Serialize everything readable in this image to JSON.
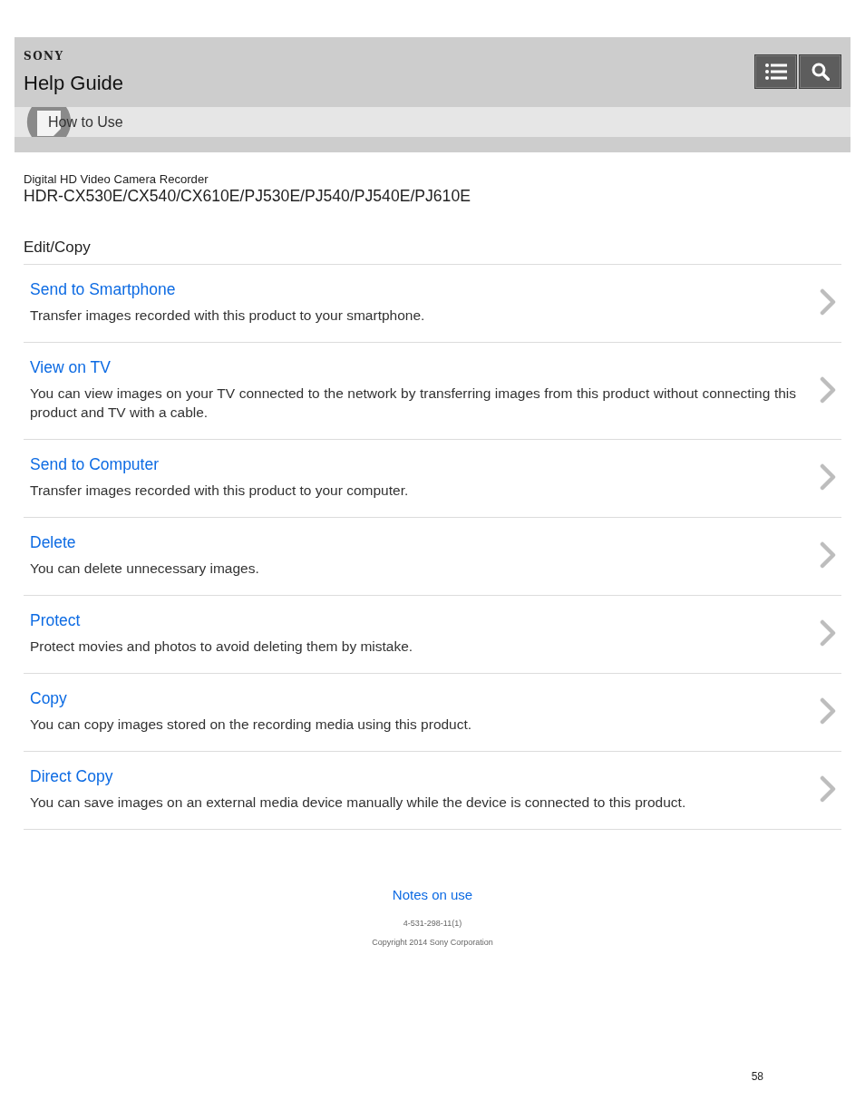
{
  "header": {
    "logo": "SONY",
    "title": "Help Guide",
    "breadcrumb": "How to Use"
  },
  "product": {
    "type": "Digital HD Video Camera Recorder",
    "models": "HDR-CX530E/CX540/CX610E/PJ530E/PJ540/PJ540E/PJ610E"
  },
  "section": {
    "title": "Edit/Copy",
    "items": [
      {
        "title": "Send to Smartphone",
        "description": "Transfer images recorded with this product to your smartphone."
      },
      {
        "title": "View on TV",
        "description": "You can view images on your TV connected to the network by transferring images from this product without connecting this product and TV with a cable."
      },
      {
        "title": "Send to Computer",
        "description": "Transfer images recorded with this product to your computer."
      },
      {
        "title": "Delete",
        "description": "You can delete unnecessary images."
      },
      {
        "title": "Protect",
        "description": "Protect movies and photos to avoid deleting them by mistake."
      },
      {
        "title": "Copy",
        "description": "You can copy images stored on the recording media using this product."
      },
      {
        "title": "Direct Copy",
        "description": "You can save images on an external media device manually while the device is connected to this product."
      }
    ]
  },
  "footer": {
    "link": "Notes on use",
    "code": "4-531-298-11(1)",
    "copyright": "Copyright 2014 Sony Corporation"
  },
  "page_number": "58"
}
